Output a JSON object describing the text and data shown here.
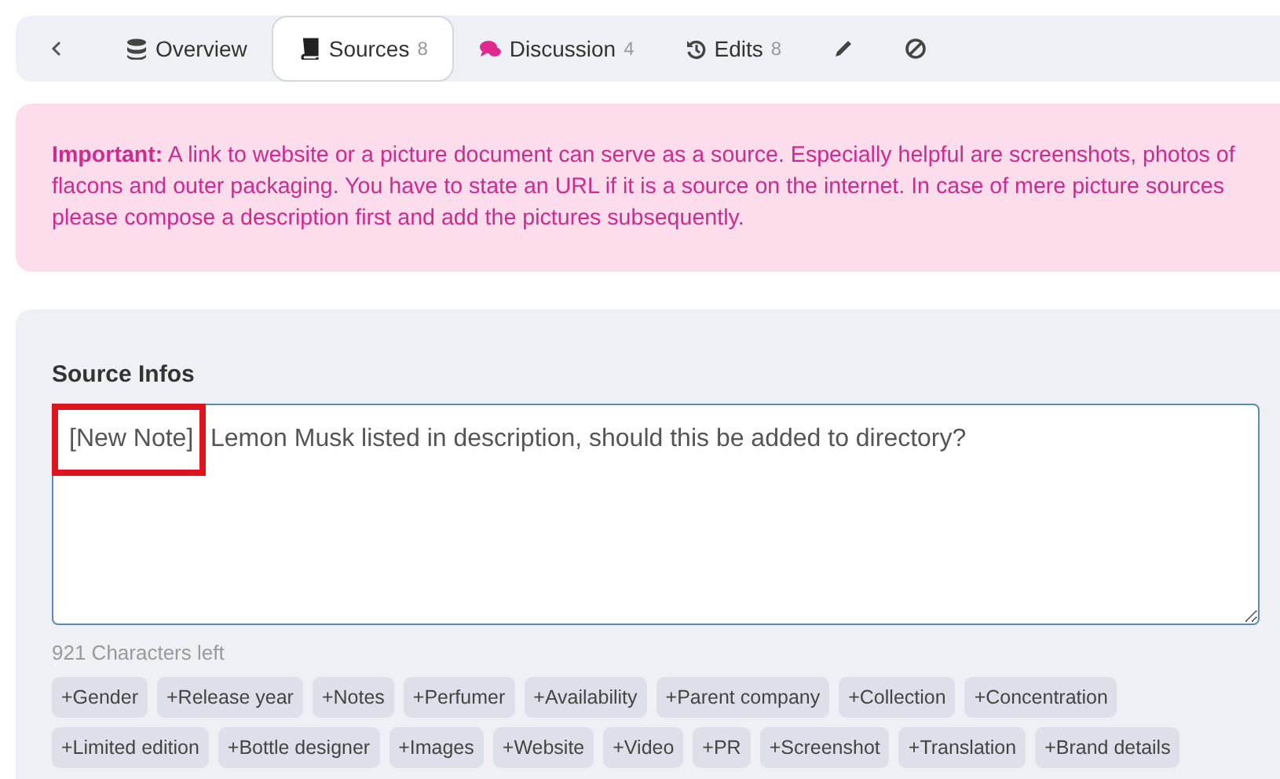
{
  "nav": {
    "tabs": [
      {
        "label": "Overview",
        "selected": false
      },
      {
        "label": "Sources",
        "count": "8",
        "selected": true
      },
      {
        "label": "Discussion",
        "count": "4",
        "selected": false
      },
      {
        "label": "Edits",
        "count": "8",
        "selected": false
      },
      {
        "selected": false
      },
      {
        "selected": false
      }
    ]
  },
  "notice": {
    "text": "**Important:** A link to website or a picture document can serve as a source. Especially helpful are screenshots, photos of flacons and outer packaging. You have to state an URL if it is a source on the internet. In case of mere picture sources please compose a description first and add the pictures subsequently."
  },
  "source_form": {
    "label": "Source Infos",
    "note_tag": "[New Note]",
    "value": "Lemon Musk listed in description, should this be added to directory?",
    "chars_left": "921 Characters left",
    "tags": [
      "+Gender",
      "+Release year",
      "+Notes",
      "+Perfumer",
      "+Availability",
      "+Parent company",
      "+Collection",
      "+Concentration",
      "+Limited edition",
      "+Bottle designer",
      "+Images",
      "+Website",
      "+Video",
      "+PR",
      "+Screenshot",
      "+Translation",
      "+Brand details"
    ]
  }
}
